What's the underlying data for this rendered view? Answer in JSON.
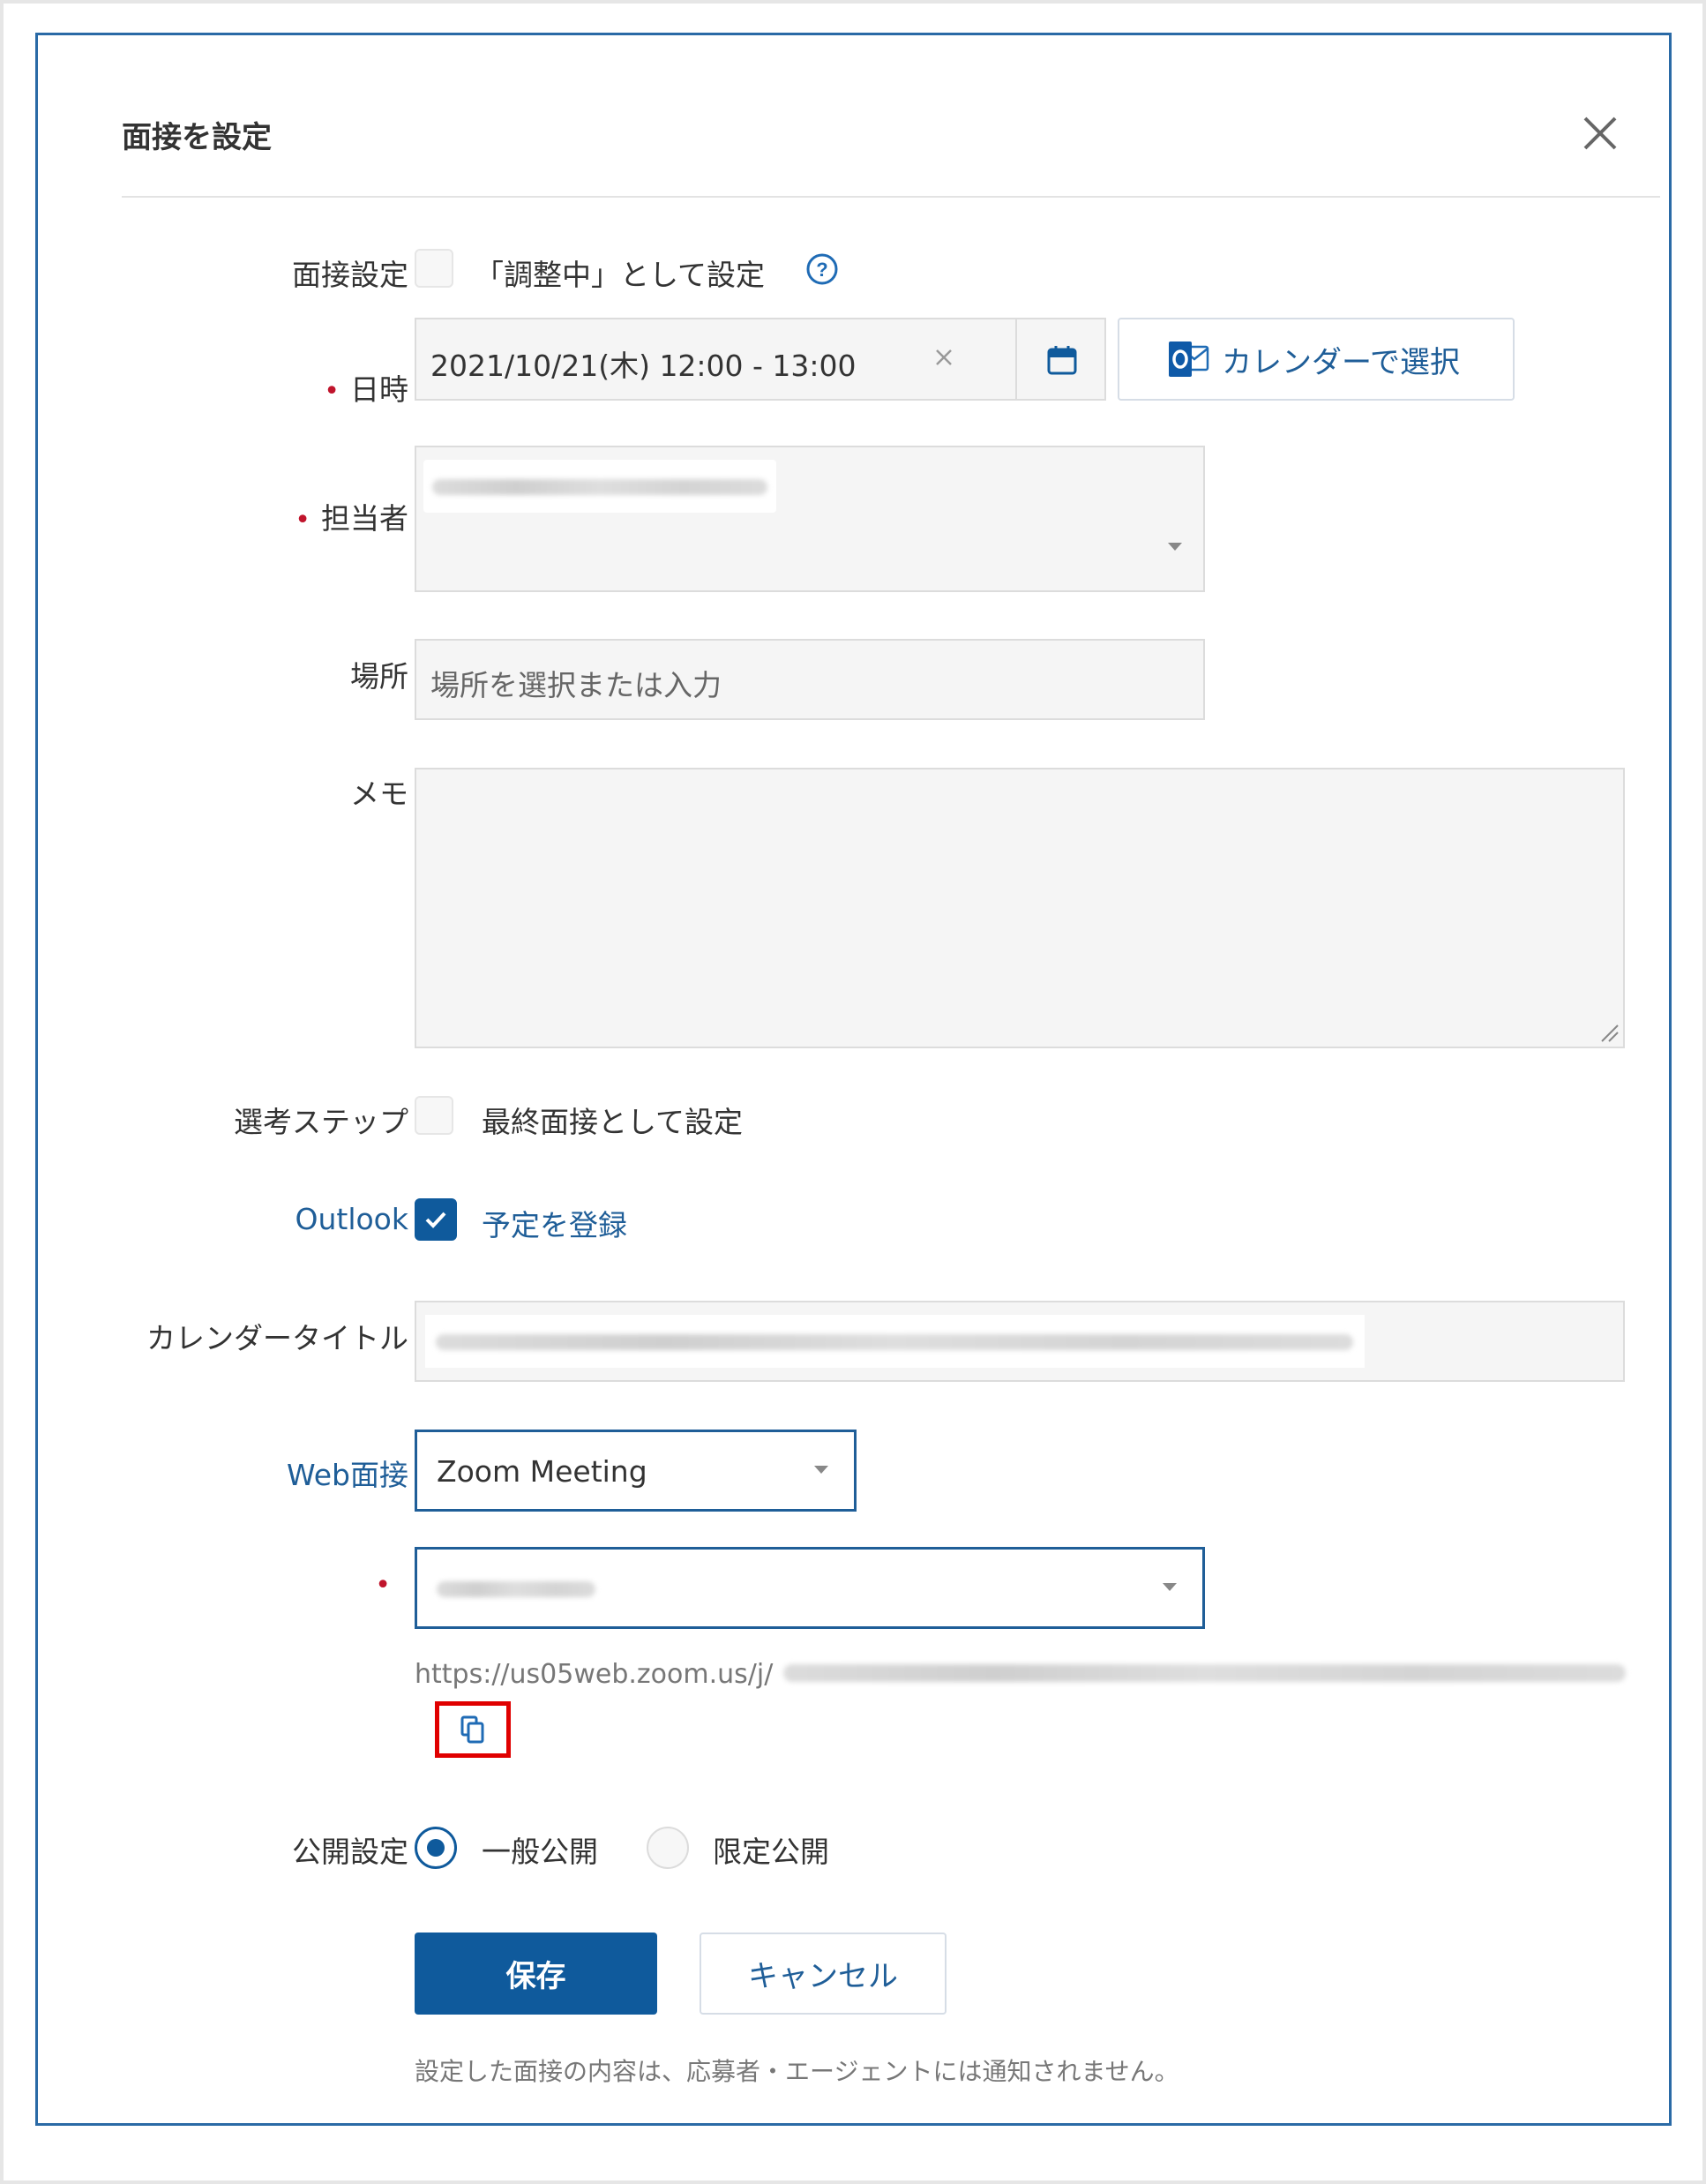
{
  "dialog": {
    "title": "面接を設定",
    "close_icon": "close-icon"
  },
  "interview_setting": {
    "label": "面接設定",
    "checkbox_label": "「調整中」として設定",
    "help_icon": "question-circle-icon",
    "checked": false
  },
  "datetime": {
    "label": "日時",
    "required_mark": "•",
    "value": "2021/10/21(木) 12:00 - 13:00",
    "clear_icon": "clear-icon",
    "calendar_icon": "calendar-icon",
    "calendar_select_label": "カレンダーで選択",
    "outlook_icon": "outlook-icon"
  },
  "assignee": {
    "label": "担当者",
    "required_mark": "•"
  },
  "location": {
    "label": "場所",
    "placeholder": "場所を選択または入力"
  },
  "memo": {
    "label": "メモ",
    "value": ""
  },
  "selection_step": {
    "label": "選考ステップ",
    "checkbox_label": "最終面接として設定",
    "checked": false
  },
  "outlook": {
    "label": "Outlook",
    "checkbox_label": "予定を登録",
    "checked": true
  },
  "calendar_title": {
    "label": "カレンダータイトル"
  },
  "web_interview": {
    "label": "Web面接",
    "selected": "Zoom Meeting",
    "account_required_mark": "•",
    "url_prefix": "https://us05web.zoom.us/j/",
    "copy_icon": "copy-icon"
  },
  "visibility": {
    "label": "公開設定",
    "options": [
      "一般公開",
      "限定公開"
    ],
    "selected": "一般公開"
  },
  "actions": {
    "save_label": "保存",
    "cancel_label": "キャンセル",
    "note": "設定した面接の内容は、応募者・エージェントには通知されません。"
  },
  "colors": {
    "primary": "#0f5a9c",
    "required": "#c0142c",
    "highlight": "#e00000"
  }
}
